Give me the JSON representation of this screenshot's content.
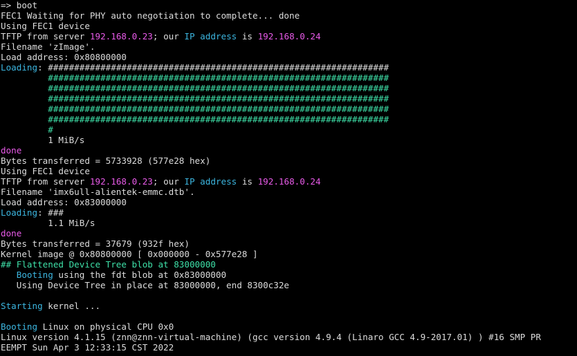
{
  "colors": {
    "background": "#000000",
    "default": "#dcdcdc",
    "magenta": "#e85ae8",
    "cyan": "#3cb6e0",
    "green": "#3ee0a8"
  },
  "lines": [
    [
      {
        "t": "=> boot",
        "c": "default"
      }
    ],
    [
      {
        "t": "FEC1 Waiting for PHY auto negotiation to complete... done",
        "c": "default"
      }
    ],
    [
      {
        "t": "Using FEC1 device",
        "c": "default"
      }
    ],
    [
      {
        "t": "TFTP from server ",
        "c": "default"
      },
      {
        "t": "192.168.0.23",
        "c": "magenta"
      },
      {
        "t": "; our ",
        "c": "default"
      },
      {
        "t": "IP address",
        "c": "cyan"
      },
      {
        "t": " is ",
        "c": "default"
      },
      {
        "t": "192.168.0.24",
        "c": "magenta"
      }
    ],
    [
      {
        "t": "Filename 'zImage'.",
        "c": "default"
      }
    ],
    [
      {
        "t": "Load address: 0x80800000",
        "c": "default"
      }
    ],
    [
      {
        "t": "Loading",
        "c": "cyan"
      },
      {
        "t": ": ",
        "c": "default"
      },
      {
        "t": "#################################################################",
        "c": "default"
      }
    ],
    [
      {
        "t": "         ",
        "c": "default"
      },
      {
        "t": "#################################################################",
        "c": "green"
      }
    ],
    [
      {
        "t": "         ",
        "c": "default"
      },
      {
        "t": "#################################################################",
        "c": "green"
      }
    ],
    [
      {
        "t": "         ",
        "c": "default"
      },
      {
        "t": "#################################################################",
        "c": "green"
      }
    ],
    [
      {
        "t": "         ",
        "c": "default"
      },
      {
        "t": "#################################################################",
        "c": "green"
      }
    ],
    [
      {
        "t": "         ",
        "c": "default"
      },
      {
        "t": "#################################################################",
        "c": "green"
      }
    ],
    [
      {
        "t": "         ",
        "c": "default"
      },
      {
        "t": "#",
        "c": "green"
      }
    ],
    [
      {
        "t": "         1 MiB/s",
        "c": "default"
      }
    ],
    [
      {
        "t": "done",
        "c": "magenta"
      }
    ],
    [
      {
        "t": "Bytes transferred = 5733928 (577e28 hex)",
        "c": "default"
      }
    ],
    [
      {
        "t": "Using FEC1 device",
        "c": "default"
      }
    ],
    [
      {
        "t": "TFTP from server ",
        "c": "default"
      },
      {
        "t": "192.168.0.23",
        "c": "magenta"
      },
      {
        "t": "; our ",
        "c": "default"
      },
      {
        "t": "IP address",
        "c": "cyan"
      },
      {
        "t": " is ",
        "c": "default"
      },
      {
        "t": "192.168.0.24",
        "c": "magenta"
      }
    ],
    [
      {
        "t": "Filename 'imx6ull-alientek-emmc.dtb'.",
        "c": "default"
      }
    ],
    [
      {
        "t": "Load address: 0x83000000",
        "c": "default"
      }
    ],
    [
      {
        "t": "Loading",
        "c": "cyan"
      },
      {
        "t": ": ###",
        "c": "default"
      }
    ],
    [
      {
        "t": "         1.1 MiB/s",
        "c": "default"
      }
    ],
    [
      {
        "t": "done",
        "c": "magenta"
      }
    ],
    [
      {
        "t": "Bytes transferred = 37679 (932f hex)",
        "c": "default"
      }
    ],
    [
      {
        "t": "Kernel image @ 0x80800000 [ 0x000000 - 0x577e28 ]",
        "c": "default"
      }
    ],
    [
      {
        "t": "## Flattened Device Tree blob at 83000000",
        "c": "green"
      }
    ],
    [
      {
        "t": "   ",
        "c": "default"
      },
      {
        "t": "Booting",
        "c": "cyan"
      },
      {
        "t": " using the fdt blob at 0x83000000",
        "c": "default"
      }
    ],
    [
      {
        "t": "   Using Device Tree in place at 83000000, end 8300c32e",
        "c": "default"
      }
    ],
    [
      {
        "t": "",
        "c": "default"
      }
    ],
    [
      {
        "t": "Starting",
        "c": "cyan"
      },
      {
        "t": " kernel ...",
        "c": "default"
      }
    ],
    [
      {
        "t": "",
        "c": "default"
      }
    ],
    [
      {
        "t": "Booting",
        "c": "cyan"
      },
      {
        "t": " Linux on physical CPU 0x0",
        "c": "default"
      }
    ],
    [
      {
        "t": "Linux version 4.1.15 (znn@znn-virtual-machine) (gcc version 4.9.4 (Linaro GCC 4.9-2017.01) ) #16 SMP PR",
        "c": "default"
      }
    ],
    [
      {
        "t": "EEMPT Sun Apr 3 12:33:15 CST 2022",
        "c": "default"
      }
    ]
  ]
}
